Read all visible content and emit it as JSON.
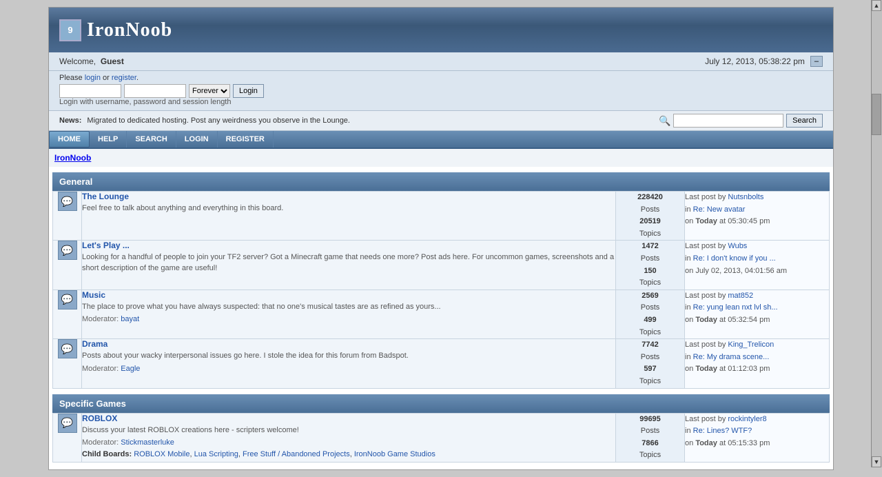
{
  "site": {
    "title": "IronNoob",
    "logo_letter": "9"
  },
  "header": {
    "welcome_prefix": "Welcome,",
    "username": "Guest",
    "date": "July 12, 2013, 05:38:22 pm"
  },
  "login_bar": {
    "prefix": "Please",
    "login_link": "login",
    "or": "or",
    "register_link": "register",
    "suffix": ".",
    "username_placeholder": "",
    "password_placeholder": "",
    "forever_option": "Forever",
    "login_button": "Login",
    "session_hint": "Login with username, password and session length"
  },
  "news": {
    "label": "News:",
    "text": "Migrated to dedicated hosting. Post any weirdness you observe in the Lounge.",
    "search_placeholder": "",
    "search_button": "Search"
  },
  "nav": {
    "items": [
      {
        "label": "HOME",
        "id": "home"
      },
      {
        "label": "HELP",
        "id": "help"
      },
      {
        "label": "SEARCH",
        "id": "search"
      },
      {
        "label": "LOGIN",
        "id": "login"
      },
      {
        "label": "REGISTER",
        "id": "register"
      }
    ]
  },
  "breadcrumb": "IronNoob",
  "sections": [
    {
      "id": "general",
      "title": "General",
      "forums": [
        {
          "id": "lounge",
          "name": "The Lounge",
          "description": "Feel free to talk about anything and everything in this board.",
          "moderator": null,
          "child_boards": null,
          "stats": {
            "posts": "228420",
            "posts_label": "Posts",
            "topics": "20519",
            "topics_label": "Topics"
          },
          "last_post": {
            "prefix": "Last post",
            "by": "by",
            "author": "Nutsnbolts",
            "in_prefix": "in",
            "thread": "Re: New avatar",
            "on_prefix": "on",
            "time_prefix": "Today",
            "at": "at",
            "time": "05:30:45 pm"
          }
        },
        {
          "id": "lets-play",
          "name": "Let's Play ...",
          "description": "Looking for a handful of people to join your TF2 server? Got a Minecraft game that needs one more? Post ads here. For uncommon games, screenshots and a short description of the game are useful!",
          "moderator": null,
          "child_boards": null,
          "stats": {
            "posts": "1472",
            "posts_label": "Posts",
            "topics": "150",
            "topics_label": "Topics"
          },
          "last_post": {
            "prefix": "Last post",
            "by": "by",
            "author": "Wubs",
            "in_prefix": "in",
            "thread": "Re: I don't know if you ...",
            "on_prefix": "on",
            "time_prefix": "July 02, 2013,",
            "at": "",
            "time": "04:01:56 am"
          }
        },
        {
          "id": "music",
          "name": "Music",
          "description": "The place to prove what you have always suspected: that no one's musical tastes are as refined as yours...",
          "moderator": "bayat",
          "child_boards": null,
          "stats": {
            "posts": "2569",
            "posts_label": "Posts",
            "topics": "499",
            "topics_label": "Topics"
          },
          "last_post": {
            "prefix": "Last post",
            "by": "by",
            "author": "mat852",
            "in_prefix": "in",
            "thread": "Re: yung lean nxt lvl sh...",
            "on_prefix": "on",
            "time_prefix": "Today",
            "at": "at",
            "time": "05:32:54 pm"
          }
        },
        {
          "id": "drama",
          "name": "Drama",
          "description": "Posts about your wacky interpersonal issues go here. I stole the idea for this forum from Badspot.",
          "moderator": "Eagle",
          "child_boards": null,
          "stats": {
            "posts": "7742",
            "posts_label": "Posts",
            "topics": "597",
            "topics_label": "Topics"
          },
          "last_post": {
            "prefix": "Last post",
            "by": "by",
            "author": "King_Trelicon",
            "in_prefix": "in",
            "thread": "Re: My drama scene...",
            "on_prefix": "on",
            "time_prefix": "Today",
            "at": "at",
            "time": "01:12:03 pm"
          }
        }
      ]
    },
    {
      "id": "specific-games",
      "title": "Specific Games",
      "forums": [
        {
          "id": "roblox",
          "name": "ROBLOX",
          "description": "Discuss your latest ROBLOX creations here - scripters welcome!",
          "moderator": "Stickmasterluke",
          "child_boards": [
            "ROBLOX Mobile",
            "Lua Scripting",
            "Free Stuff / Abandoned Projects",
            "IronNoob Game Studios"
          ],
          "stats": {
            "posts": "99695",
            "posts_label": "Posts",
            "topics": "7866",
            "topics_label": "Topics"
          },
          "last_post": {
            "prefix": "Last post",
            "by": "by",
            "author": "rockintyler8",
            "in_prefix": "in",
            "thread": "Re: Lines? WTF?",
            "on_prefix": "on",
            "time_prefix": "Today",
            "at": "at",
            "time": "05:15:33 pm"
          }
        }
      ]
    }
  ]
}
